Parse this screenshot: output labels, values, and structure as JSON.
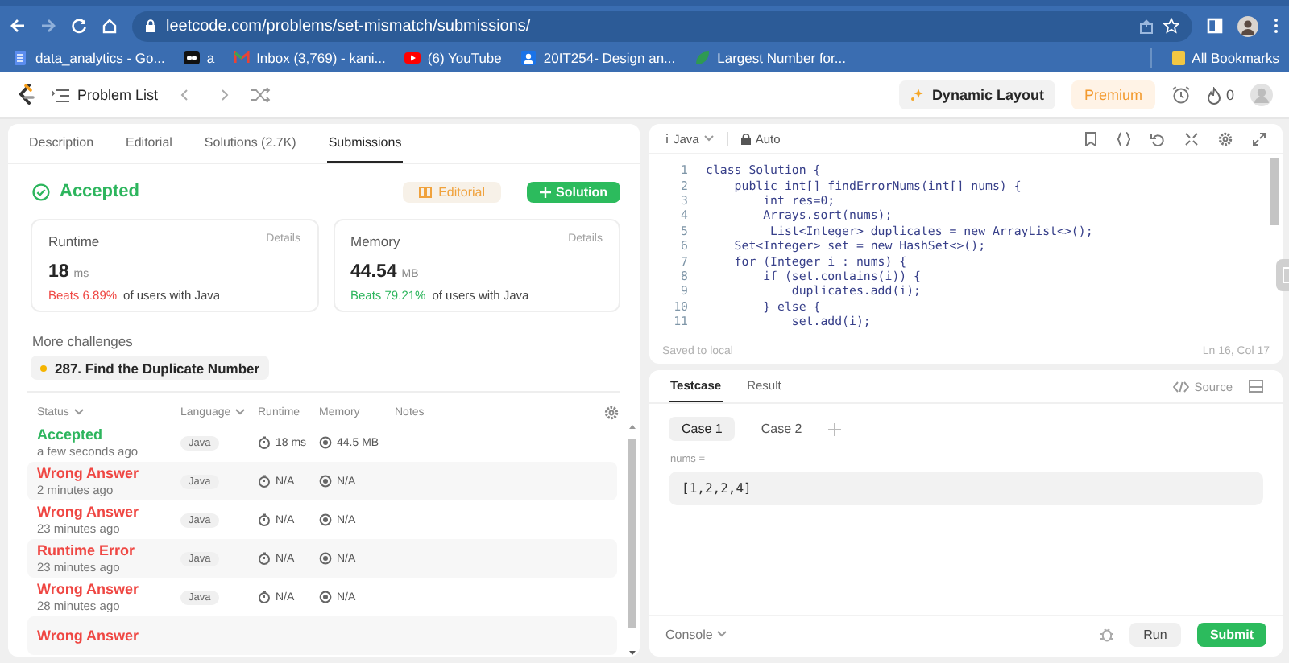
{
  "browser": {
    "url": "leetcode.com/problems/set-mismatch/submissions/",
    "bookmarks": [
      {
        "kind": "doc",
        "label": "data_analytics - Go..."
      },
      {
        "kind": "tab",
        "label": "a"
      },
      {
        "kind": "mail",
        "label": "Inbox (3,769) - kani..."
      },
      {
        "kind": "video",
        "label": "(6) YouTube"
      },
      {
        "kind": "person",
        "label": "20IT254- Design an..."
      },
      {
        "kind": "leaf",
        "label": "Largest Number for..."
      }
    ],
    "all_bookmarks": "All Bookmarks"
  },
  "header": {
    "problem_list": "Problem List",
    "dynamic_layout": "Dynamic Layout",
    "premium": "Premium",
    "streak": "0"
  },
  "left": {
    "tabs": [
      {
        "label": "Description",
        "selected": false
      },
      {
        "label": "Editorial",
        "selected": false
      },
      {
        "label": "Solutions (2.7K)",
        "selected": false
      },
      {
        "label": "Submissions",
        "selected": true
      }
    ],
    "result": "Accepted",
    "editorial_button": "Editorial",
    "solution_button": "Solution",
    "stats": [
      {
        "label": "Runtime",
        "details": "Details",
        "value": "18",
        "unit": "ms",
        "beats": "Beats 6.89%",
        "good": false,
        "suffix": "of users with Java"
      },
      {
        "label": "Memory",
        "details": "Details",
        "value": "44.54",
        "unit": "MB",
        "beats": "Beats 79.21%",
        "good": true,
        "suffix": "of users with Java"
      }
    ],
    "more_challenges": "More challenges",
    "challenges": [
      {
        "title": "287. Find the Duplicate Number"
      }
    ],
    "columns": [
      {
        "label": "Status",
        "sortable": true
      },
      {
        "label": "Language",
        "sortable": true
      },
      {
        "label": "Runtime",
        "sortable": false
      },
      {
        "label": "Memory",
        "sortable": false
      },
      {
        "label": "Notes",
        "sortable": false
      }
    ],
    "rows": [
      {
        "kind": "accepted",
        "status": "Accepted",
        "time": "a few seconds ago",
        "language": "Java",
        "runtime": "18 ms",
        "memory": "44.5 MB"
      },
      {
        "kind": "failed",
        "status": "Wrong Answer",
        "time": "2 minutes ago",
        "language": "Java",
        "runtime": "N/A",
        "memory": "N/A"
      },
      {
        "kind": "failed",
        "status": "Wrong Answer",
        "time": "23 minutes ago",
        "language": "Java",
        "runtime": "N/A",
        "memory": "N/A"
      },
      {
        "kind": "failed",
        "status": "Runtime Error",
        "time": "23 minutes ago",
        "language": "Java",
        "runtime": "N/A",
        "memory": "N/A"
      },
      {
        "kind": "failed",
        "status": "Wrong Answer",
        "time": "28 minutes ago",
        "language": "Java",
        "runtime": "N/A",
        "memory": "N/A"
      },
      {
        "kind": "failed",
        "status": "Wrong Answer"
      }
    ]
  },
  "editor": {
    "language": "Java",
    "mode": "Auto",
    "lines": [
      {
        "number": "1",
        "code": "class Solution {"
      },
      {
        "number": "2",
        "code": "    public int[] findErrorNums(int[] nums) {"
      },
      {
        "number": "3",
        "code": "        int res=0;"
      },
      {
        "number": "4",
        "code": "        Arrays.sort(nums);"
      },
      {
        "number": "5",
        "code": "         List<Integer> duplicates = new ArrayList<>();"
      },
      {
        "number": "6",
        "code": "    Set<Integer> set = new HashSet<>();"
      },
      {
        "number": "7",
        "code": "    for (Integer i : nums) {"
      },
      {
        "number": "8",
        "code": "        if (set.contains(i)) {"
      },
      {
        "number": "9",
        "code": "            duplicates.add(i);"
      },
      {
        "number": "10",
        "code": "        } else {"
      },
      {
        "number": "11",
        "code": "            set.add(i);"
      }
    ],
    "saved": "Saved to local",
    "cursor": "Ln 16, Col 17"
  },
  "testcase": {
    "tabs": [
      {
        "label": "Testcase",
        "selected": true
      },
      {
        "label": "Result",
        "selected": false
      }
    ],
    "source": "Source",
    "cases": [
      {
        "label": "Case 1",
        "selected": true
      },
      {
        "label": "Case 2",
        "selected": false
      }
    ],
    "param": "nums =",
    "value": "[1,2,2,4]",
    "console": "Console",
    "run": "Run",
    "submit": "Submit"
  }
}
